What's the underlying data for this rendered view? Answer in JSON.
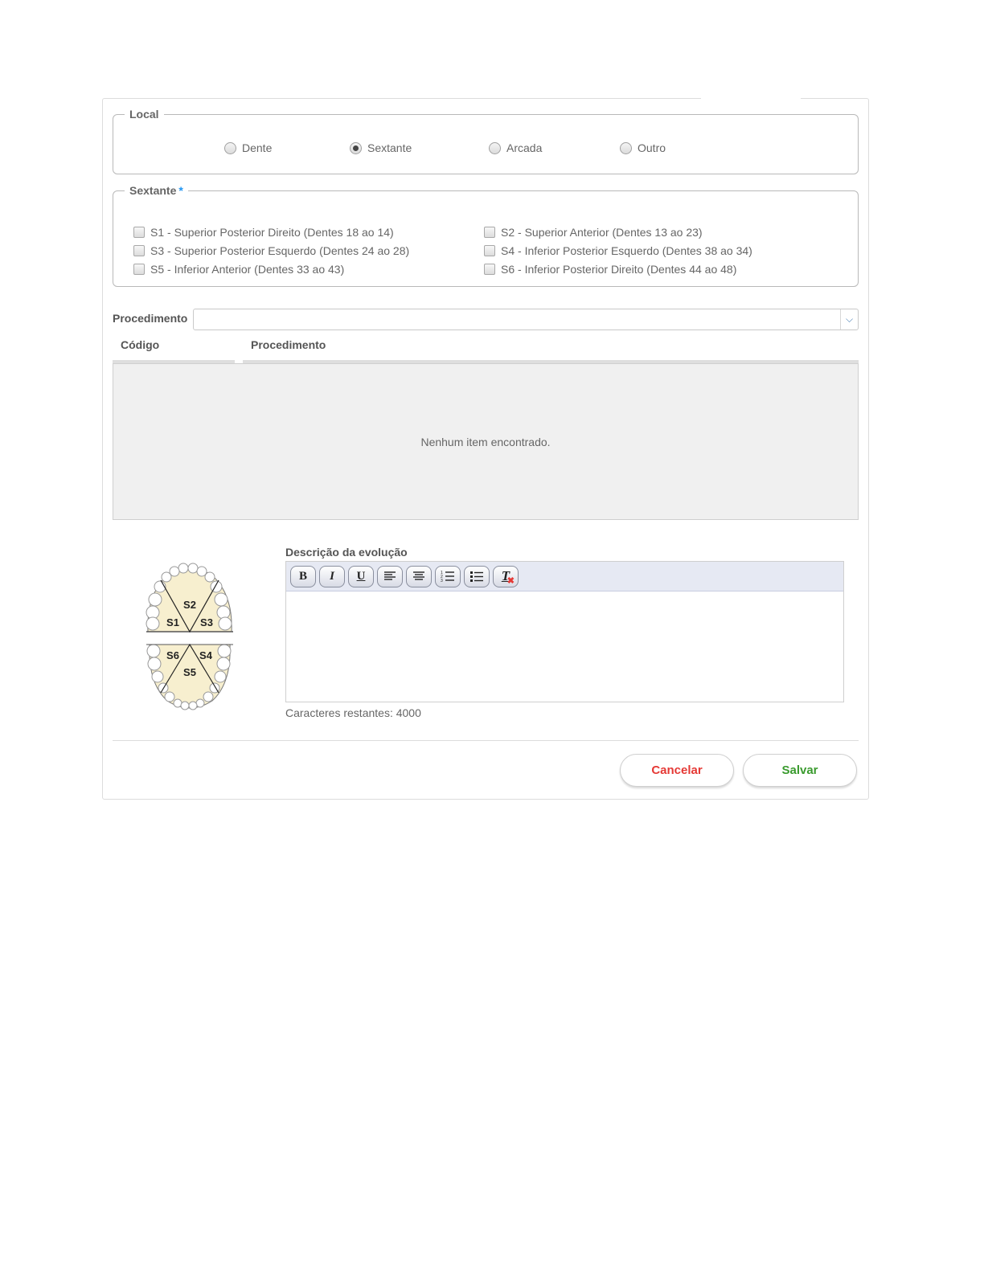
{
  "local": {
    "legend": "Local",
    "options": [
      {
        "label": "Dente",
        "checked": false
      },
      {
        "label": "Sextante",
        "checked": true
      },
      {
        "label": "Arcada",
        "checked": false
      },
      {
        "label": "Outro",
        "checked": false
      }
    ]
  },
  "sextante": {
    "legend": "Sextante",
    "required_mark": "*",
    "options": [
      {
        "label": "S1 - Superior Posterior Direito (Dentes 18 ao 14)",
        "checked": false
      },
      {
        "label": "S2 - Superior Anterior (Dentes 13 ao 23)",
        "checked": false
      },
      {
        "label": "S3 - Superior Posterior Esquerdo (Dentes 24 ao 28)",
        "checked": false
      },
      {
        "label": "S4 - Inferior Posterior Esquerdo (Dentes 38 ao 34)",
        "checked": false
      },
      {
        "label": "S5 - Inferior Anterior (Dentes 33 ao 43)",
        "checked": false
      },
      {
        "label": "S6 - Inferior Posterior Direito (Dentes 44 ao 48)",
        "checked": false
      }
    ]
  },
  "procedimento": {
    "label": "Procedimento",
    "value": "",
    "table": {
      "columns": [
        "Código",
        "Procedimento"
      ],
      "empty_text": "Nenhum item encontrado."
    }
  },
  "diagram": {
    "labels": [
      "S1",
      "S2",
      "S3",
      "S4",
      "S5",
      "S6"
    ]
  },
  "descricao": {
    "label": "Descrição da evolução",
    "toolbar": [
      {
        "icon": "bold-icon",
        "glyph": "B"
      },
      {
        "icon": "italic-icon",
        "glyph": "I"
      },
      {
        "icon": "underline-icon",
        "glyph": "U"
      },
      {
        "icon": "align-left-icon",
        "glyph": ""
      },
      {
        "icon": "align-center-icon",
        "glyph": ""
      },
      {
        "icon": "ordered-list-icon",
        "glyph": ""
      },
      {
        "icon": "unordered-list-icon",
        "glyph": ""
      },
      {
        "icon": "clear-format-icon",
        "glyph": "T"
      }
    ],
    "value": "",
    "chars_remaining": "Caracteres restantes: 4000"
  },
  "actions": {
    "cancel_label": "Cancelar",
    "save_label": "Salvar",
    "cancel_color": "#e53935",
    "save_color": "#3a9b2e"
  }
}
